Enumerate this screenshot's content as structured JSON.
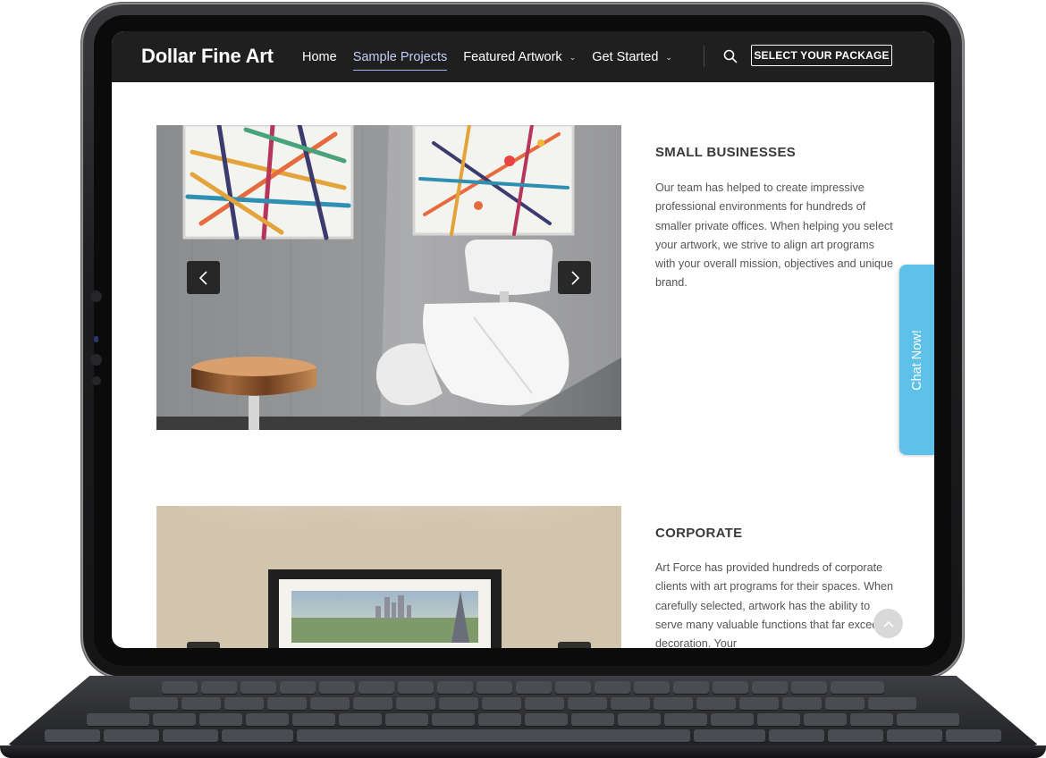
{
  "header": {
    "brand": "Dollar Fine Art",
    "nav": [
      {
        "label": "Home",
        "active": false,
        "has_dropdown": false
      },
      {
        "label": "Sample Projects",
        "active": true,
        "has_dropdown": false
      },
      {
        "label": "Featured Artwork",
        "active": false,
        "has_dropdown": true
      },
      {
        "label": "Get Started",
        "active": false,
        "has_dropdown": true
      }
    ],
    "search_icon": "search-icon",
    "package_button": "SELECT YOUR PACKAGE"
  },
  "sections": [
    {
      "title": "SMALL BUSINESSES",
      "text": "Our team has helped to create impressive professional environments for hundreds of smaller private offices. When helping you select your artwork, we strive to align art programs with your overall mission, objectives and unique brand."
    },
    {
      "title": "CORPORATE",
      "text": "Art Force has provided hundreds of corporate clients with art programs for their spaces. When carefully selected, artwork has the ability to serve many valuable functions that far exceed decoration. Your"
    }
  ],
  "chat": {
    "label": "Chat Now!"
  },
  "colors": {
    "header_bg": "#1f1f1f",
    "nav_active": "#c2cff7",
    "chat_tab": "#5ec1ea",
    "body_text": "#555555"
  },
  "icons": {
    "prev": "chevron-left-icon",
    "next": "chevron-right-icon",
    "back_to_top": "chevron-up-icon"
  }
}
